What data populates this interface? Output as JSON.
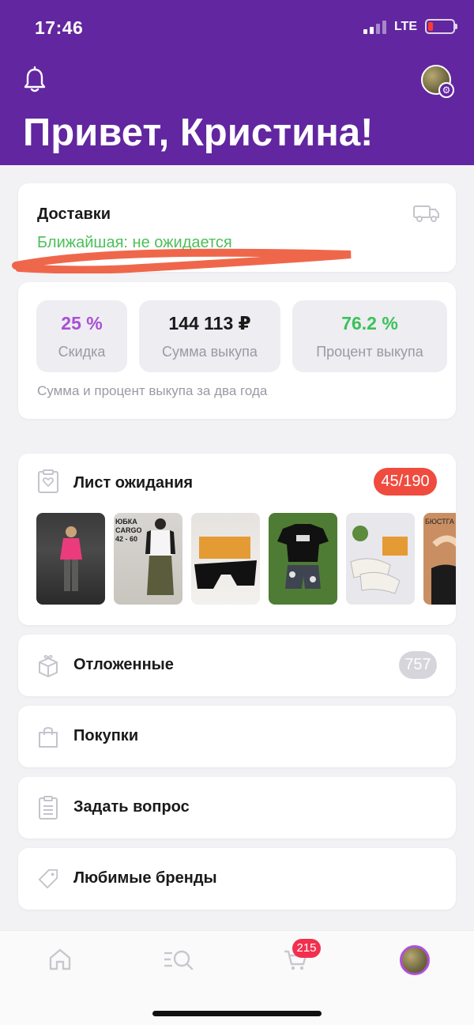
{
  "status_bar": {
    "time": "17:46",
    "network": "LTE",
    "battery_level": 0.12
  },
  "header": {
    "greeting": "Привет, Кристина!"
  },
  "deliveries": {
    "title": "Доставки",
    "subtitle": "Ближайшая: не ожидается"
  },
  "stats": {
    "items": [
      {
        "value": "25 %",
        "label": "Скидка",
        "color": "#a94fd6"
      },
      {
        "value": "144 113 ₽",
        "label": "Сумма выкупа",
        "color": "#1a1a1a"
      },
      {
        "value": "76.2 %",
        "label": "Процент выкупа",
        "color": "#3cc159"
      }
    ],
    "note": "Сумма и процент выкупа за два года"
  },
  "wishlist": {
    "title": "Лист ожидания",
    "badge": "45/190",
    "thumb_texts": {
      "skirt": [
        "ЮБКА",
        "CARGO",
        "42 - 60"
      ],
      "bra": "БЮСТГА"
    }
  },
  "menu": {
    "deferred": {
      "label": "Отложенные",
      "badge": "757"
    },
    "purchases": {
      "label": "Покупки"
    },
    "ask": {
      "label": "Задать вопрос"
    },
    "brands": {
      "label": "Любимые бренды"
    }
  },
  "tabbar": {
    "cart_badge": "215"
  },
  "colors": {
    "header_bg": "#6226a0",
    "accent_green": "#4cbf5a",
    "badge_red": "#ef4b3f"
  }
}
